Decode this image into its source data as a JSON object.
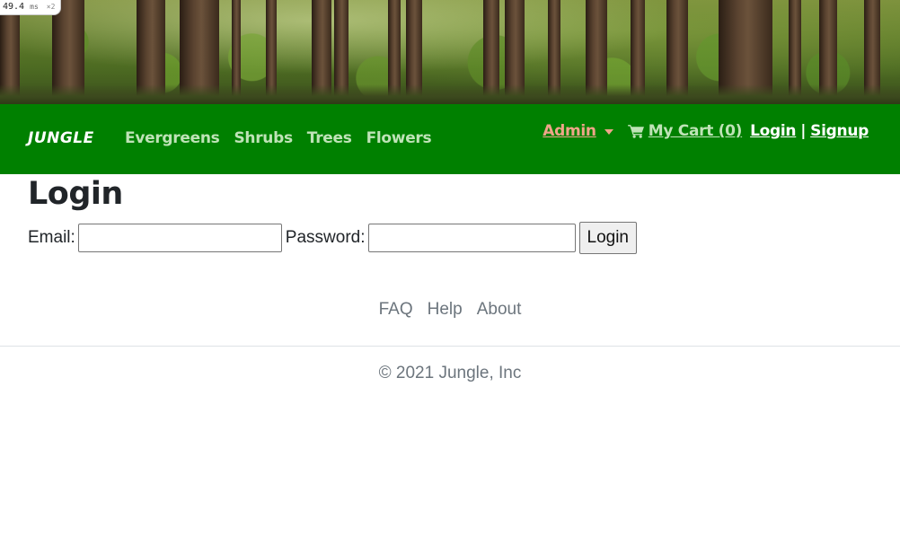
{
  "perf_badge": {
    "value": "49.4",
    "unit": "ms",
    "multiplier": "×2"
  },
  "navbar": {
    "brand": "JUNGLE",
    "links": [
      "Evergreens",
      "Shrubs",
      "Trees",
      "Flowers"
    ],
    "admin_label": "Admin",
    "cart_label": "My Cart (0)",
    "login_label": "Login",
    "separator": "|",
    "signup_label": "Signup"
  },
  "main": {
    "title": "Login",
    "email_label": "Email:",
    "email_value": "",
    "password_label": "Password:",
    "password_value": "",
    "submit_label": "Login"
  },
  "footer": {
    "links": [
      "FAQ",
      "Help",
      "About"
    ],
    "copyright": "© 2021 Jungle, Inc"
  },
  "colors": {
    "navbar_bg": "#008000",
    "nav_link": "#bfe3b7",
    "admin_accent": "#f0a589",
    "muted_text": "#6c757d"
  },
  "icons": {
    "cart": "shopping-cart-icon",
    "admin_caret": "caret-down-icon"
  }
}
